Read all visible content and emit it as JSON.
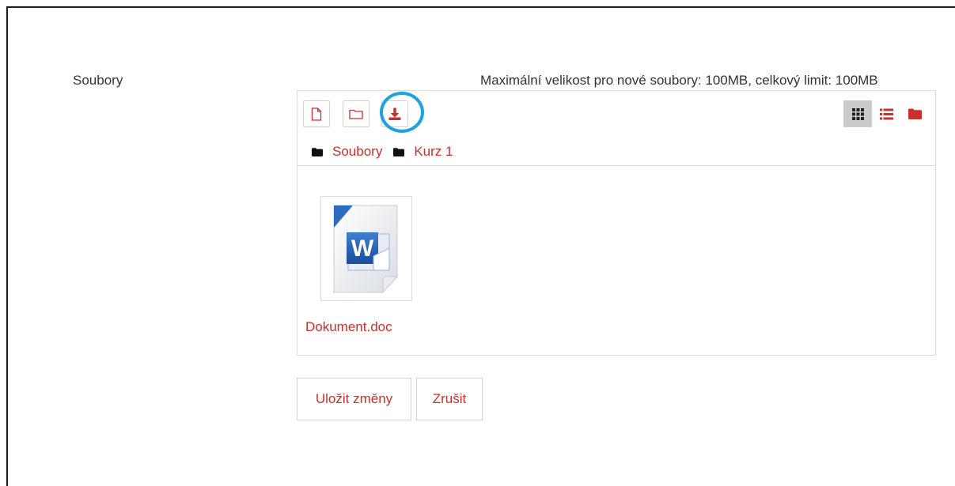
{
  "field": {
    "label": "Soubory",
    "limits_text": "Maximální velikost pro nové soubory: 100MB, celkový limit: 100MB"
  },
  "toolbar": {
    "buttons": [
      {
        "icon": "new-file-icon"
      },
      {
        "icon": "new-folder-icon"
      },
      {
        "icon": "download-icon"
      }
    ],
    "view_modes": [
      {
        "icon": "grid-view-icon",
        "active": true
      },
      {
        "icon": "list-view-icon",
        "active": false
      },
      {
        "icon": "folder-tree-view-icon",
        "active": false
      }
    ]
  },
  "path": {
    "items": [
      "Soubory",
      "Kurz 1"
    ]
  },
  "files": [
    {
      "name": "Dokument.doc",
      "icon": "word-document-icon"
    }
  ],
  "actions": {
    "save_label": "Uložit změny",
    "cancel_label": "Zrušit"
  },
  "colors": {
    "accent": "#c9302c",
    "highlight": "#1ba3e0",
    "active_view_bg": "#c9cbcd"
  }
}
